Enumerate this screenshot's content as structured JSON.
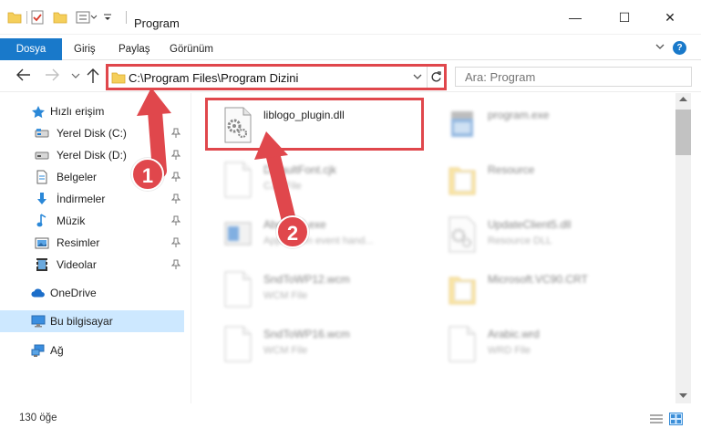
{
  "window": {
    "title": "Program",
    "controls": {
      "minimize": "—",
      "maximize": "☐",
      "close": "✕"
    }
  },
  "ribbon": {
    "tabs": [
      {
        "label": "Dosya",
        "active": true
      },
      {
        "label": "Giriş"
      },
      {
        "label": "Paylaş"
      },
      {
        "label": "Görünüm"
      }
    ],
    "help_label": "?"
  },
  "address_bar": {
    "path": "C:\\Program Files\\Program Dizini"
  },
  "search": {
    "placeholder": "Ara: Program"
  },
  "sidebar": {
    "quick_access": {
      "label": "Hızlı erişim",
      "items": [
        {
          "label": "Yerel Disk (C:)",
          "icon": "drive-icon",
          "pinned": true
        },
        {
          "label": "Yerel Disk (D:)",
          "icon": "drive-icon",
          "pinned": true
        },
        {
          "label": "Belgeler",
          "icon": "documents-icon",
          "pinned": true
        },
        {
          "label": "İndirmeler",
          "icon": "download-icon",
          "pinned": true
        },
        {
          "label": "Müzik",
          "icon": "music-icon",
          "pinned": true
        },
        {
          "label": "Resimler",
          "icon": "pictures-icon",
          "pinned": true
        },
        {
          "label": "Videolar",
          "icon": "videos-icon",
          "pinned": true
        }
      ]
    },
    "onedrive": "OneDrive",
    "this_pc": "Bu bilgisayar",
    "network": "Ağ"
  },
  "files": [
    {
      "name": "liblogo_plugin.dll",
      "type": "",
      "icon": "dll-gear-icon",
      "highlighted": true,
      "faded": false
    },
    {
      "name": "program.exe",
      "type": "",
      "icon": "exe-icon",
      "faded": true
    },
    {
      "name": "DefaultFont.cjk",
      "type": "CJK File",
      "icon": "blank-file-icon",
      "faded": true
    },
    {
      "name": "Resource",
      "type": "",
      "icon": "folder-icon",
      "faded": true
    },
    {
      "name": "AboutS0.exe",
      "type": "Application event hand...",
      "icon": "exe-window-icon",
      "faded": true
    },
    {
      "name": "UpdateClient5.dll",
      "type": "Resource DLL",
      "icon": "dll-gear-icon",
      "faded": true
    },
    {
      "name": "SndToWP12.wcm",
      "type": "WCM File",
      "icon": "blank-file-icon",
      "faded": true
    },
    {
      "name": "Microsoft.VC90.CRT",
      "type": "",
      "icon": "folder-icon",
      "faded": true
    },
    {
      "name": "SndToWP16.wcm",
      "type": "WCM File",
      "icon": "blank-file-icon",
      "faded": true
    },
    {
      "name": "Arabic.wrd",
      "type": "WRD File",
      "icon": "blank-file-icon",
      "faded": true
    }
  ],
  "status": {
    "item_count": "130 öğe"
  },
  "annotations": {
    "badge_1": "1",
    "badge_2": "2",
    "accent": "#e0474c"
  }
}
